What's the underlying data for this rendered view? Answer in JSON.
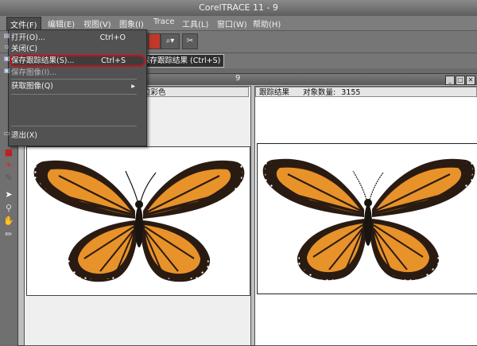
{
  "title": "CorelTRACE 11 - 9",
  "menubar": [
    {
      "name": "menu-file",
      "label": "文件(F)"
    },
    {
      "name": "menu-edit",
      "label": "编辑(E)"
    },
    {
      "name": "menu-view",
      "label": "视图(V)"
    },
    {
      "name": "menu-image",
      "label": "图象(I)"
    },
    {
      "name": "menu-trace",
      "label": "Trace"
    },
    {
      "name": "menu-tools",
      "label": "工具(L)"
    },
    {
      "name": "menu-window",
      "label": "窗口(W)"
    },
    {
      "name": "menu-help",
      "label": "帮助(H)"
    }
  ],
  "file_menu": {
    "open": {
      "label": "打开(O)...",
      "shortcut": "Ctrl+O"
    },
    "close": {
      "label": "关闭(C)"
    },
    "save_trace": {
      "label": "保存跟踪结果(S)...",
      "shortcut": "Ctrl+S"
    },
    "save_image": {
      "label": "保存图像(I)..."
    },
    "acquire": {
      "label": "获取图像(Q)"
    },
    "exit": {
      "label": "退出(X)"
    }
  },
  "tooltip": "保存跟踪结果 (Ctrl+S)",
  "doc_title": "9",
  "panes": {
    "left_header": "位彩色",
    "right_header": "跟踪结果",
    "object_count_label": "对象数量:",
    "object_count": "3155"
  },
  "colors": {
    "highlight_ring": "#c4111a",
    "butterfly_orange": "#e8922a",
    "butterfly_black": "#2a1b12"
  }
}
